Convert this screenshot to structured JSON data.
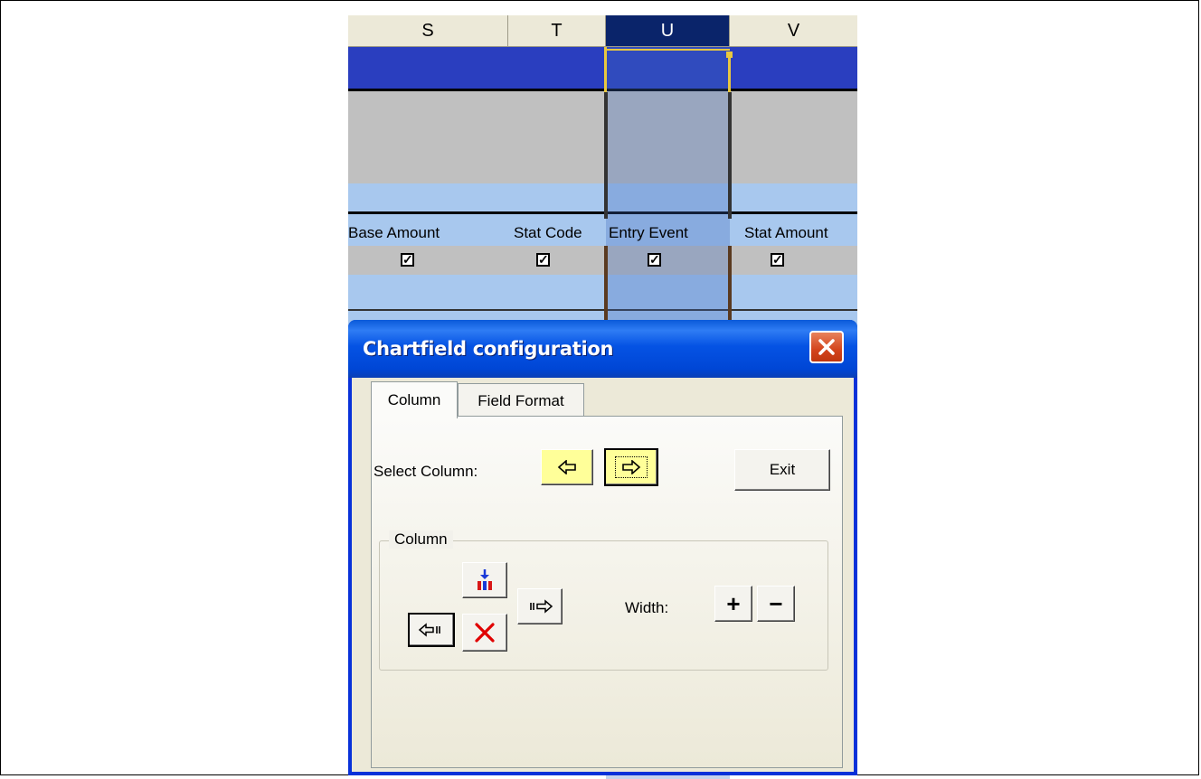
{
  "spreadsheet": {
    "columns": [
      {
        "letter": "S",
        "selected": false
      },
      {
        "letter": "T",
        "selected": false
      },
      {
        "letter": "U",
        "selected": true
      },
      {
        "letter": "V",
        "selected": false
      }
    ],
    "field_headers": [
      "Base Amount",
      "Stat Code",
      "Entry Event",
      "Stat Amount"
    ],
    "checkbox_states": [
      true,
      true,
      true,
      true
    ],
    "colors": {
      "header_row": "#2a3ebf",
      "gray_band": "#c0c0c0",
      "light_blue_band": "#a8c8ee",
      "selected_header": "#0a246a"
    }
  },
  "dialog": {
    "title": "Chartfield configuration",
    "tabs": [
      {
        "label": "Column",
        "active": true
      },
      {
        "label": "Field Format",
        "active": false
      }
    ],
    "select_column_label": "Select Column:",
    "exit_label": "Exit",
    "group_label": "Column",
    "width_label": "Width:",
    "width_increase_label": "+",
    "width_decrease_label": "−"
  },
  "icons": {
    "close": "close-icon",
    "select_prev": "arrow-left-icon",
    "select_next": "arrow-right-icon",
    "move_left": "move-column-left-icon",
    "insert": "insert-column-icon",
    "delete": "delete-column-icon",
    "move_right": "move-column-right-icon"
  }
}
